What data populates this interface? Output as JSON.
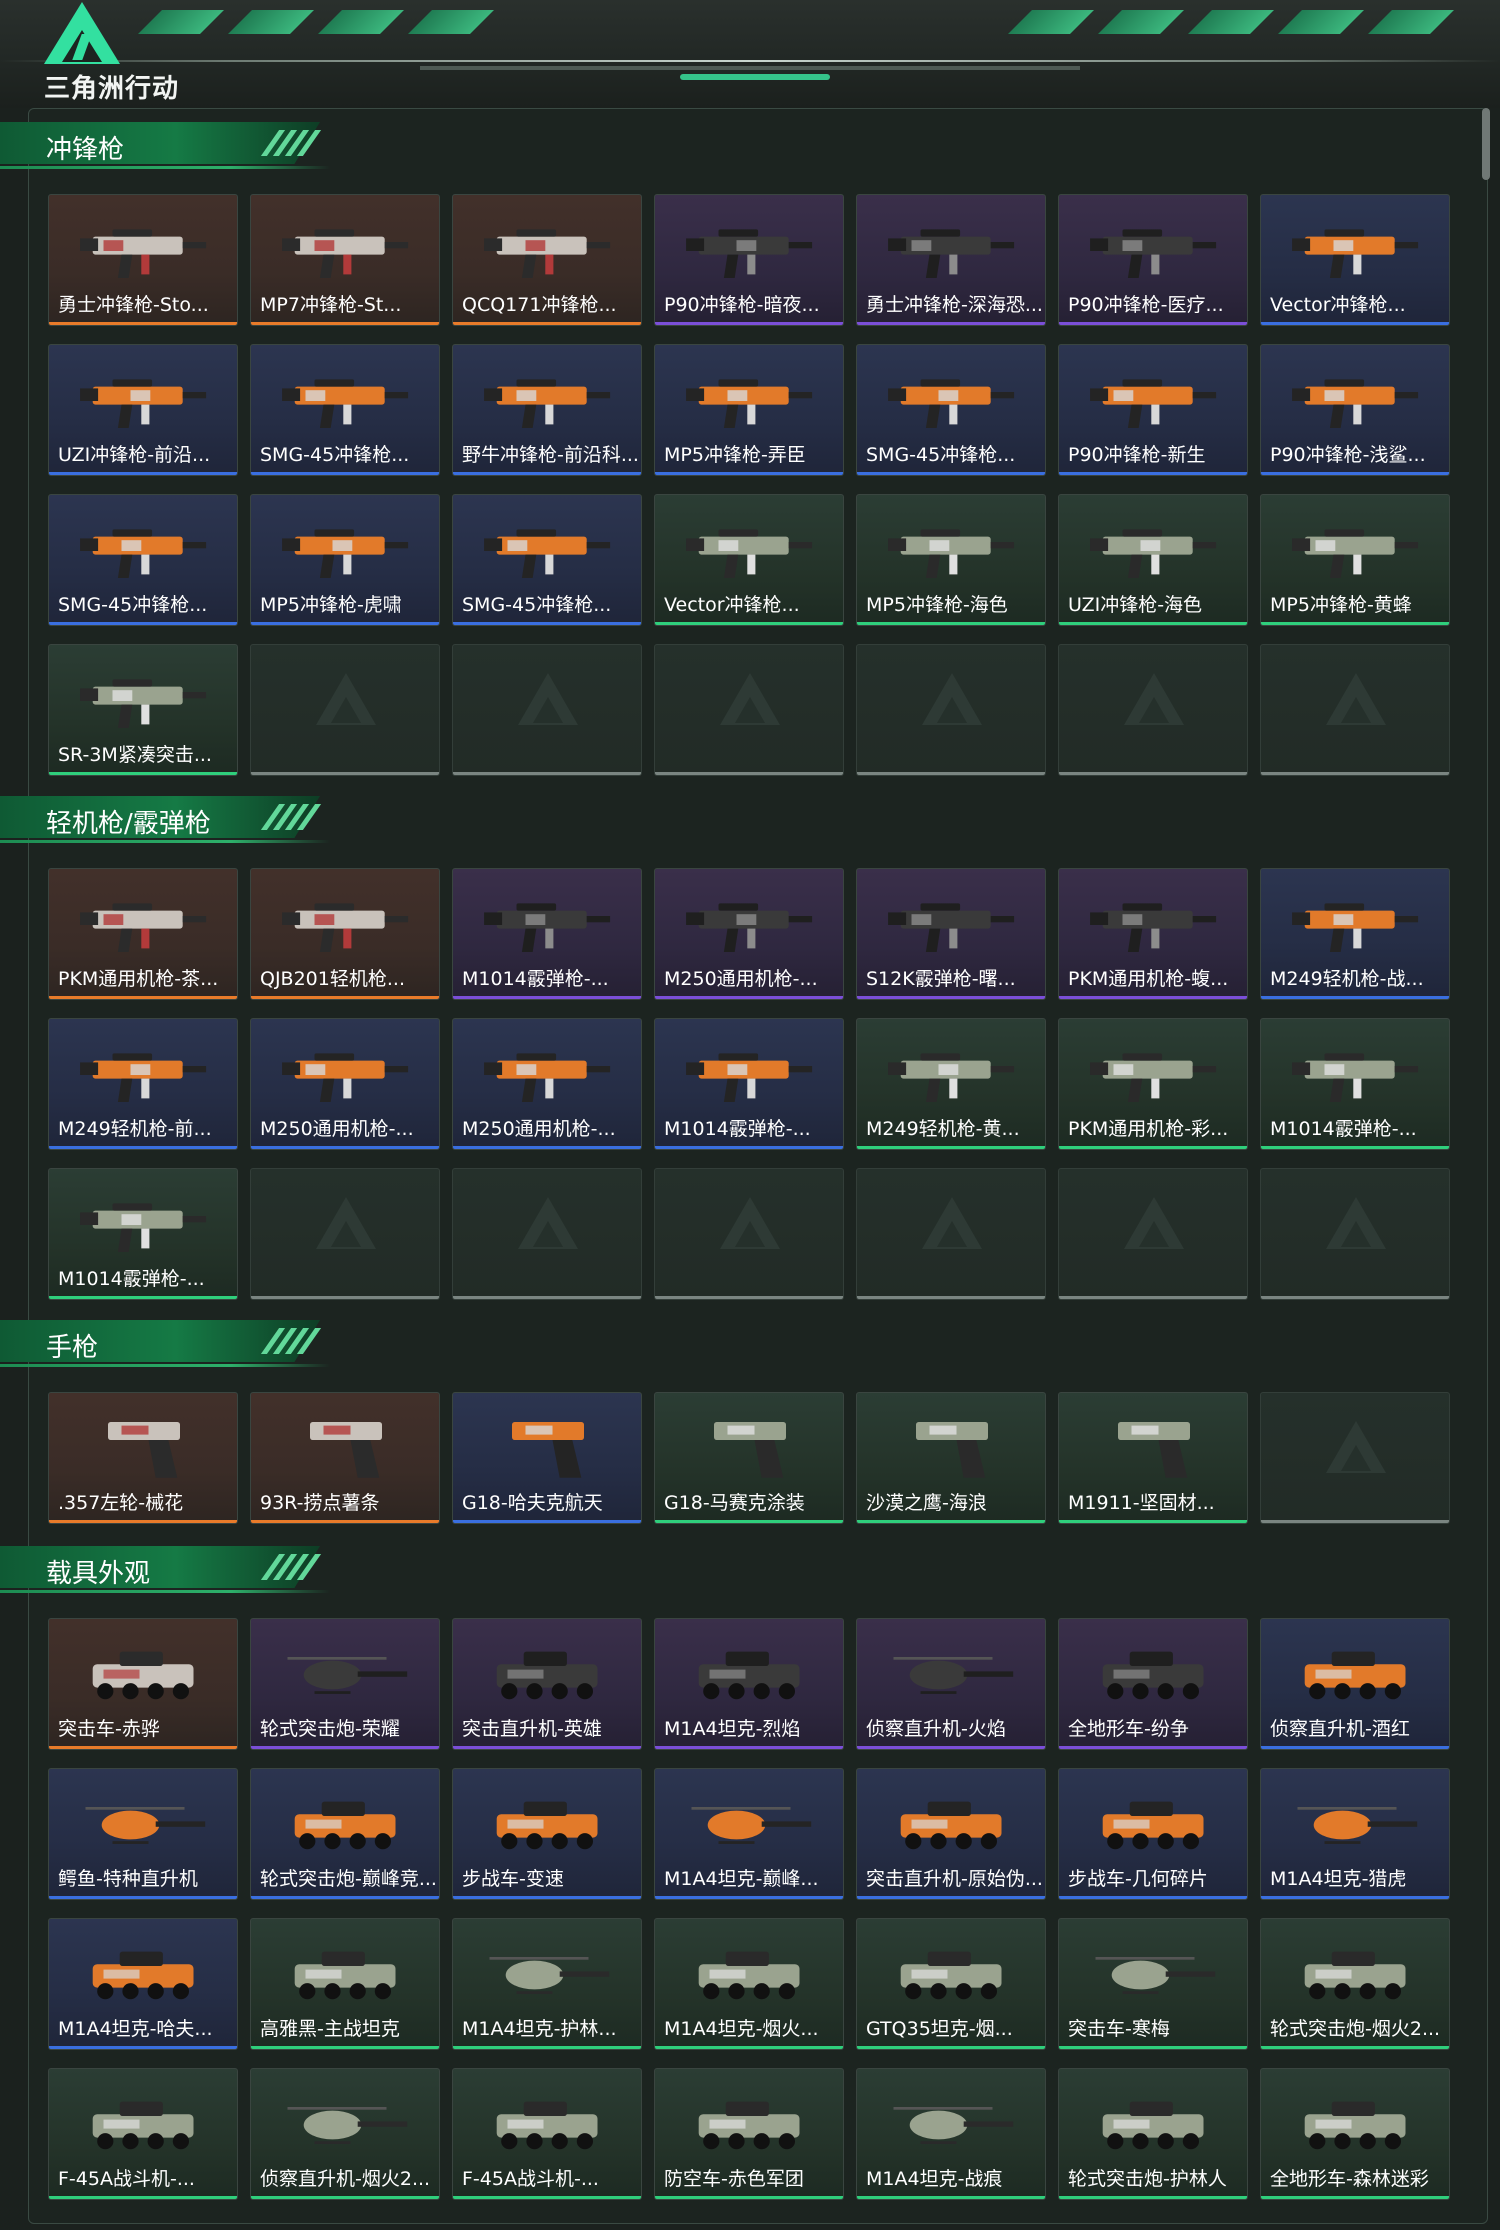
{
  "header": {
    "logo_text": "三角洲行动"
  },
  "colors": {
    "orange": "#e87b2a",
    "purple": "#7b4fd8",
    "blue": "#3a6fe0",
    "green": "#2fcf7c",
    "accent": "#33e0a0"
  },
  "sections": [
    {
      "title": "冲锋枪",
      "kind": "gun",
      "items": [
        {
          "label": "勇士冲锋枪-Sto...",
          "rarity": "orange"
        },
        {
          "label": "MP7冲锋枪-St...",
          "rarity": "orange"
        },
        {
          "label": "QCQ171冲锋枪...",
          "rarity": "orange"
        },
        {
          "label": "P90冲锋枪-暗夜...",
          "rarity": "purple"
        },
        {
          "label": "勇士冲锋枪-深海恐...",
          "rarity": "purple"
        },
        {
          "label": "P90冲锋枪-医疗...",
          "rarity": "purple"
        },
        {
          "label": "Vector冲锋枪...",
          "rarity": "blue"
        },
        {
          "label": "UZI冲锋枪-前沿...",
          "rarity": "blue"
        },
        {
          "label": "SMG-45冲锋枪...",
          "rarity": "blue"
        },
        {
          "label": "野牛冲锋枪-前沿科...",
          "rarity": "blue"
        },
        {
          "label": "MP5冲锋枪-弄臣",
          "rarity": "blue"
        },
        {
          "label": "SMG-45冲锋枪...",
          "rarity": "blue"
        },
        {
          "label": "P90冲锋枪-新生",
          "rarity": "blue"
        },
        {
          "label": "P90冲锋枪-浅鲨...",
          "rarity": "blue"
        },
        {
          "label": "SMG-45冲锋枪...",
          "rarity": "blue"
        },
        {
          "label": "MP5冲锋枪-虎啸",
          "rarity": "blue"
        },
        {
          "label": "SMG-45冲锋枪...",
          "rarity": "blue"
        },
        {
          "label": "Vector冲锋枪...",
          "rarity": "green"
        },
        {
          "label": "MP5冲锋枪-海色",
          "rarity": "green"
        },
        {
          "label": "UZI冲锋枪-海色",
          "rarity": "green"
        },
        {
          "label": "MP5冲锋枪-黄蜂",
          "rarity": "green"
        },
        {
          "label": "SR-3M紧凑突击...",
          "rarity": "green"
        }
      ],
      "empty_slots": 6
    },
    {
      "title": "轻机枪/霰弹枪",
      "kind": "gun",
      "items": [
        {
          "label": "PKM通用机枪-茶...",
          "rarity": "orange"
        },
        {
          "label": "QJB201轻机枪...",
          "rarity": "orange"
        },
        {
          "label": "M1014霰弹枪-...",
          "rarity": "purple"
        },
        {
          "label": "M250通用机枪-...",
          "rarity": "purple"
        },
        {
          "label": "S12K霰弹枪-曙...",
          "rarity": "purple"
        },
        {
          "label": "PKM通用机枪-蝮...",
          "rarity": "purple"
        },
        {
          "label": "M249轻机枪-战...",
          "rarity": "blue"
        },
        {
          "label": "M249轻机枪-前...",
          "rarity": "blue"
        },
        {
          "label": "M250通用机枪-...",
          "rarity": "blue"
        },
        {
          "label": "M250通用机枪-...",
          "rarity": "blue"
        },
        {
          "label": "M1014霰弹枪-...",
          "rarity": "blue"
        },
        {
          "label": "M249轻机枪-黄...",
          "rarity": "green"
        },
        {
          "label": "PKM通用机枪-彩...",
          "rarity": "green"
        },
        {
          "label": "M1014霰弹枪-...",
          "rarity": "green"
        },
        {
          "label": "M1014霰弹枪-...",
          "rarity": "green"
        }
      ],
      "empty_slots": 6
    },
    {
      "title": "手枪",
      "kind": "pistol",
      "items": [
        {
          "label": ".357左轮-械花",
          "rarity": "orange"
        },
        {
          "label": "93R-捞点薯条",
          "rarity": "orange"
        },
        {
          "label": "G18-哈夫克航天",
          "rarity": "blue"
        },
        {
          "label": "G18-马赛克涂装",
          "rarity": "green"
        },
        {
          "label": "沙漠之鹰-海浪",
          "rarity": "green"
        },
        {
          "label": "M1911-坚固材...",
          "rarity": "green"
        }
      ],
      "empty_slots": 1
    },
    {
      "title": "载具外观",
      "kind": "vehicle",
      "items": [
        {
          "label": "突击车-赤骅",
          "rarity": "orange"
        },
        {
          "label": "轮式突击炮-荣耀",
          "rarity": "purple"
        },
        {
          "label": "突击直升机-英雄",
          "rarity": "purple"
        },
        {
          "label": "M1A4坦克-烈焰",
          "rarity": "purple"
        },
        {
          "label": "侦察直升机-火焰",
          "rarity": "purple"
        },
        {
          "label": "全地形车-纷争",
          "rarity": "purple"
        },
        {
          "label": "侦察直升机-酒红",
          "rarity": "blue"
        },
        {
          "label": "鳄鱼-特种直升机",
          "rarity": "blue"
        },
        {
          "label": "轮式突击炮-巅峰竞...",
          "rarity": "blue"
        },
        {
          "label": "步战车-变速",
          "rarity": "blue"
        },
        {
          "label": "M1A4坦克-巅峰...",
          "rarity": "blue"
        },
        {
          "label": "突击直升机-原始伪...",
          "rarity": "blue"
        },
        {
          "label": "步战车-几何碎片",
          "rarity": "blue"
        },
        {
          "label": "M1A4坦克-猎虎",
          "rarity": "blue"
        },
        {
          "label": "M1A4坦克-哈夫...",
          "rarity": "blue"
        },
        {
          "label": "高雅黑-主战坦克",
          "rarity": "green"
        },
        {
          "label": "M1A4坦克-护林...",
          "rarity": "green"
        },
        {
          "label": "M1A4坦克-烟火...",
          "rarity": "green"
        },
        {
          "label": "GTQ35坦克-烟...",
          "rarity": "green"
        },
        {
          "label": "突击车-寒梅",
          "rarity": "green"
        },
        {
          "label": "轮式突击炮-烟火2...",
          "rarity": "green"
        },
        {
          "label": "F-45A战斗机-...",
          "rarity": "green"
        },
        {
          "label": "侦察直升机-烟火2...",
          "rarity": "green"
        },
        {
          "label": "F-45A战斗机-...",
          "rarity": "green"
        },
        {
          "label": "防空车-赤色军团",
          "rarity": "green"
        },
        {
          "label": "M1A4坦克-战痕",
          "rarity": "green"
        },
        {
          "label": "轮式突击炮-护林人",
          "rarity": "green"
        },
        {
          "label": "全地形车-森林迷彩",
          "rarity": "green"
        }
      ],
      "empty_slots": 0
    }
  ]
}
